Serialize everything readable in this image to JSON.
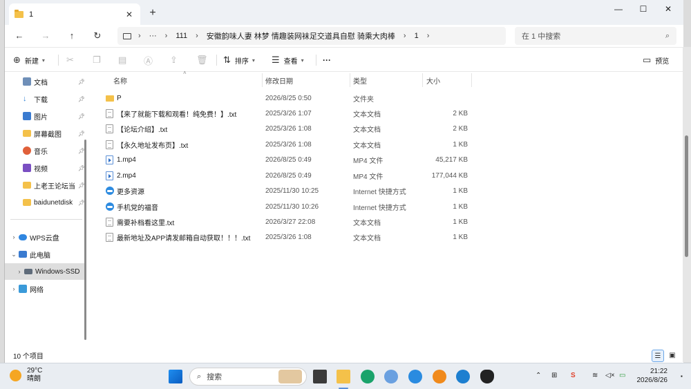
{
  "window": {
    "tab_title": "1",
    "new_tab": "+",
    "close_tab": "✕"
  },
  "nav": {
    "back": "←",
    "forward": "→",
    "up": "↑",
    "refresh": "↻",
    "breadcrumb": [
      "···",
      "111",
      "安徽韵味人妻 林梦 情趣装网袜足交道具自慰 骑乘大肉棒",
      "1"
    ],
    "search_placeholder": "在 1 中搜索"
  },
  "toolbar": {
    "new_label": "新建",
    "sort_label": "排序",
    "view_label": "查看",
    "more_label": "···",
    "preview_label": "预览"
  },
  "sidebar": {
    "items": [
      {
        "label": "文档",
        "pinned": true,
        "icon": "document-icon"
      },
      {
        "label": "下载",
        "pinned": true,
        "icon": "download-icon"
      },
      {
        "label": "图片",
        "pinned": true,
        "icon": "picture-icon"
      },
      {
        "label": "屏幕截图",
        "pinned": true,
        "icon": "folder-icon"
      },
      {
        "label": "音乐",
        "pinned": true,
        "icon": "music-icon"
      },
      {
        "label": "视频",
        "pinned": true,
        "icon": "video-icon"
      },
      {
        "label": "上老王论坛当",
        "pinned": true,
        "icon": "folder-icon"
      },
      {
        "label": "baidunetdisk",
        "pinned": true,
        "icon": "folder-icon"
      }
    ],
    "tree": [
      {
        "label": "WPS云盘",
        "icon": "cloud-icon",
        "expanded": false
      },
      {
        "label": "此电脑",
        "icon": "computer-icon",
        "expanded": true
      },
      {
        "label": "Windows-SSD",
        "icon": "drive-icon",
        "expanded": false
      },
      {
        "label": "网络",
        "icon": "network-icon",
        "expanded": false
      }
    ]
  },
  "columns": {
    "name": "名称",
    "date": "修改日期",
    "type": "类型",
    "size": "大小"
  },
  "files": [
    {
      "name": "P",
      "date": "2026/8/25 0:50",
      "type": "文件夹",
      "size": "",
      "kind": "folder"
    },
    {
      "name": "【来了就能下载和观看！纯免费！】.txt",
      "date": "2025/3/26 1:07",
      "type": "文本文档",
      "size": "2 KB",
      "kind": "txt"
    },
    {
      "name": "【论坛介绍】.txt",
      "date": "2025/3/26 1:08",
      "type": "文本文档",
      "size": "2 KB",
      "kind": "txt"
    },
    {
      "name": "【永久地址发布页】.txt",
      "date": "2025/3/26 1:08",
      "type": "文本文档",
      "size": "1 KB",
      "kind": "txt"
    },
    {
      "name": "1.mp4",
      "date": "2026/8/25 0:49",
      "type": "MP4 文件",
      "size": "45,217 KB",
      "kind": "mp4"
    },
    {
      "name": "2.mp4",
      "date": "2026/8/25 0:49",
      "type": "MP4 文件",
      "size": "177,044 KB",
      "kind": "mp4"
    },
    {
      "name": "更多资源",
      "date": "2025/11/30 10:25",
      "type": "Internet 快捷方式",
      "size": "1 KB",
      "kind": "url"
    },
    {
      "name": "手机党的福音",
      "date": "2025/11/30 10:26",
      "type": "Internet 快捷方式",
      "size": "1 KB",
      "kind": "url"
    },
    {
      "name": "需要补档看这里.txt",
      "date": "2026/3/27 22:08",
      "type": "文本文档",
      "size": "1 KB",
      "kind": "txt"
    },
    {
      "name": "最新地址及APP请发邮箱自动获取！！！.txt",
      "date": "2025/3/26 1:08",
      "type": "文本文档",
      "size": "1 KB",
      "kind": "txt"
    }
  ],
  "status": {
    "item_count": "10 个项目"
  },
  "taskbar": {
    "temperature": "29°C",
    "weather": "晴朗",
    "search_label": "搜索",
    "time": "21:22",
    "date": "2026/8/26"
  },
  "colors": {
    "accent": "#0067c0",
    "folder": "#f4c14a",
    "taskbar": "#e9edf2"
  }
}
